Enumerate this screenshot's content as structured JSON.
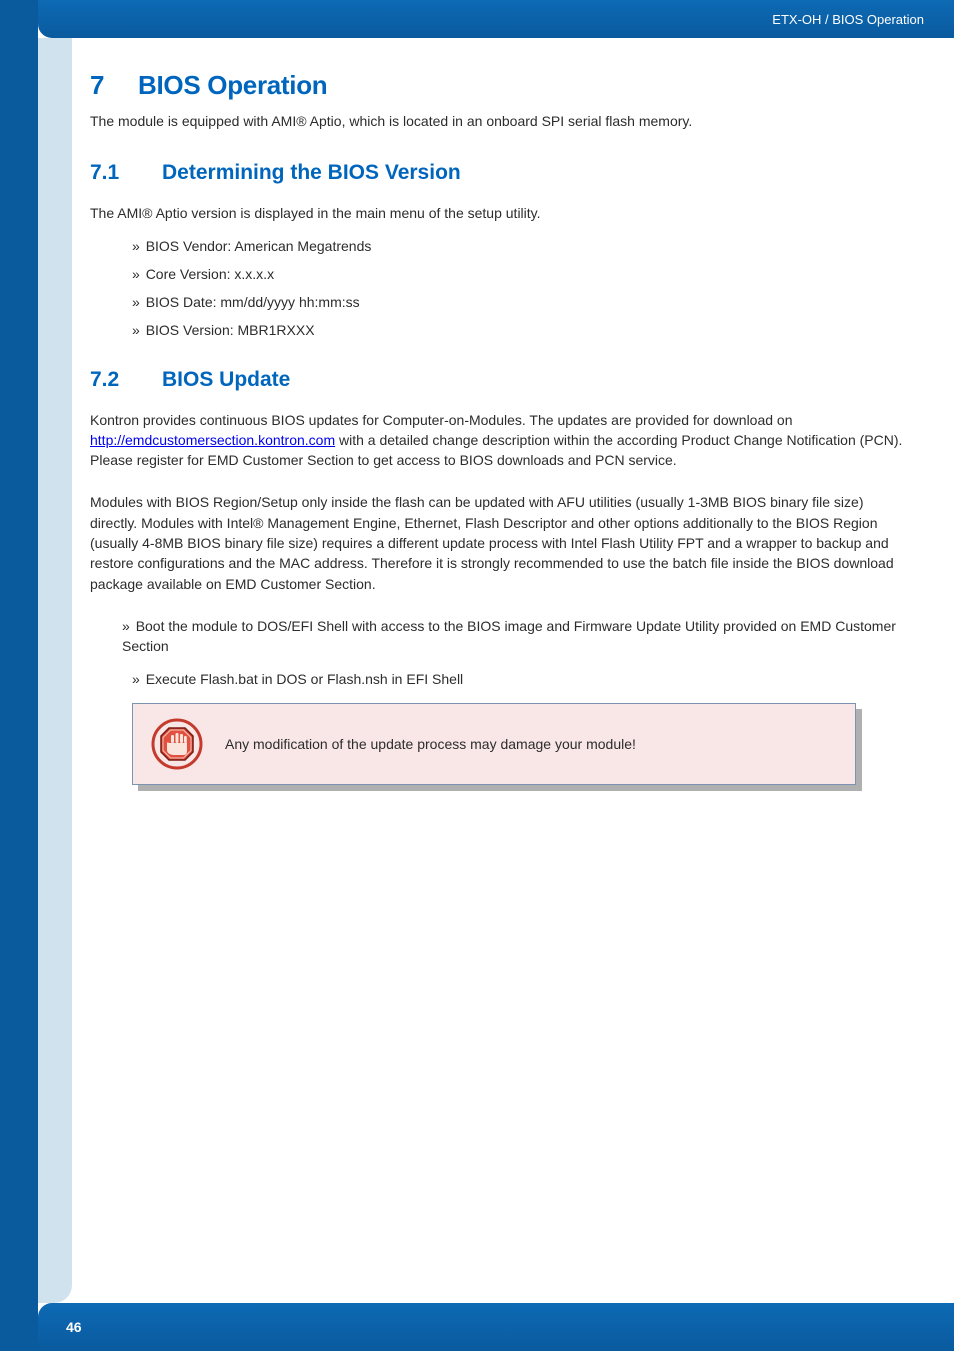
{
  "header": {
    "breadcrumb": "ETX-OH / BIOS Operation"
  },
  "footer": {
    "page_number": "46"
  },
  "section7": {
    "number": "7",
    "title": "BIOS Operation",
    "intro": "The module is equipped with AMI® Aptio, which is located in an onboard SPI serial flash memory."
  },
  "section71": {
    "number": "7.1",
    "title": "Determining the BIOS Version",
    "intro": "The AMI® Aptio version is displayed in the main menu of the setup utility.",
    "items": [
      "BIOS Vendor: American Megatrends",
      "Core Version: x.x.x.x",
      "BIOS Date: mm/dd/yyyy hh:mm:ss",
      "BIOS Version: MBR1RXXX"
    ]
  },
  "section72": {
    "number": "7.2",
    "title": "BIOS Update",
    "para1_before_link": "Kontron provides continuous BIOS updates for Computer-on-Modules. The updates are provided for download on ",
    "link_text": "http://emdcustomersection.kontron.com",
    "para1_after_link": " with a detailed change description within the according Product Change Notification (PCN). Please register for EMD Customer Section to get access to BIOS downloads and PCN service.",
    "para2": "Modules with BIOS Region/Setup only inside the flash can be updated with AFU utilities (usually 1-3MB BIOS binary file size) directly. Modules with Intel® Management Engine, Ethernet, Flash Descriptor and other options additionally to the BIOS Region (usually 4-8MB BIOS binary file size) requires a different update process with Intel Flash Utility FPT and a wrapper to backup and restore configurations and the MAC address. Therefore it is strongly recommended to use the batch file inside the BIOS download package available on EMD Customer Section.",
    "steps": [
      "Boot the module to DOS/EFI Shell with access to the BIOS image and Firmware Update Utility provided on EMD Customer Section",
      "Execute Flash.bat in DOS or Flash.nsh in EFI Shell"
    ],
    "warning": "Any modification of the update process may damage your module!"
  },
  "bullet_prefix": "» "
}
